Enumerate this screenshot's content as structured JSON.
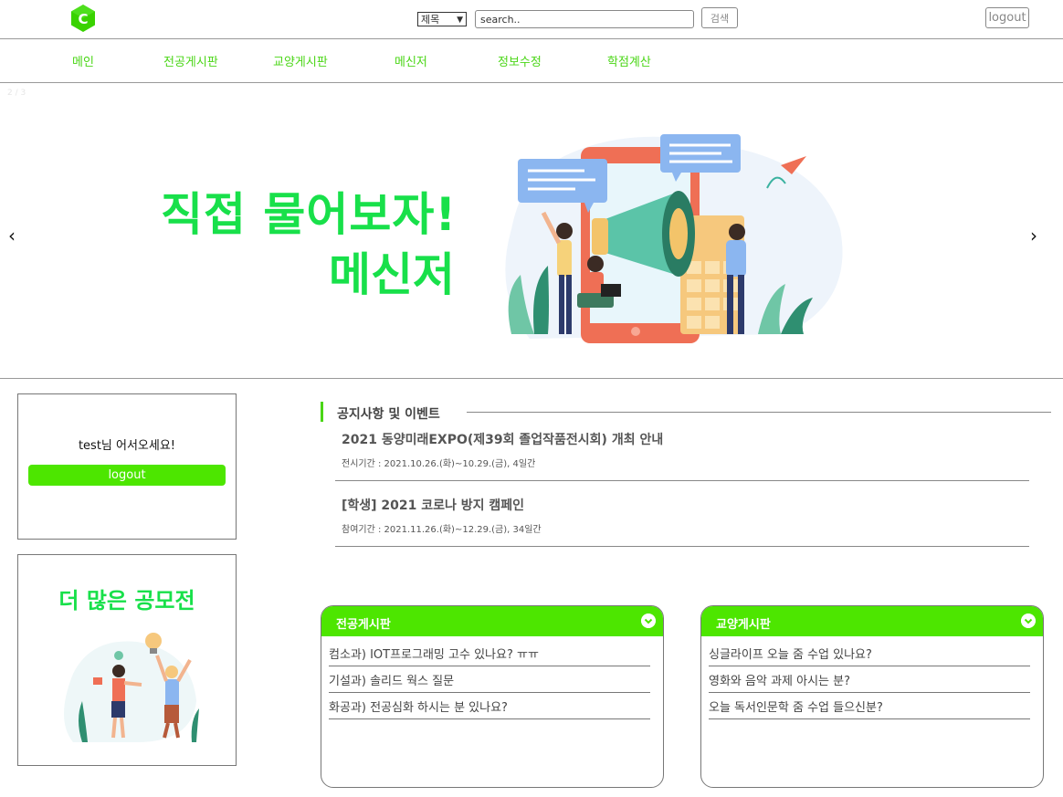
{
  "header": {
    "logo_letter": "C",
    "search_select_value": "제목",
    "search_placeholder": "search..",
    "search_button": "검색",
    "logout_button": "logout"
  },
  "nav": {
    "items": [
      {
        "label": "메인"
      },
      {
        "label": "전공게시판"
      },
      {
        "label": "교양게시판"
      },
      {
        "label": "메신저"
      },
      {
        "label": "정보수정"
      },
      {
        "label": "학점계산"
      }
    ]
  },
  "banner": {
    "slide_counter": "2 / 3",
    "line1": "직접 물어보자!",
    "line2": "메신저",
    "prev_arrow": "‹",
    "next_arrow": "›"
  },
  "welcome": {
    "text": "test님 어서오세요!",
    "logout_button": "logout"
  },
  "contest": {
    "title": "더 많은 공모전"
  },
  "notices": {
    "title": "공지사항 및 이벤트",
    "items": [
      {
        "title": "2021 동양미래EXPO(제39회 졸업작품전시회) 개최 안내",
        "period": "전시기간 : 2021.10.26.(화)~10.29.(금), 4일간"
      },
      {
        "title": "[학생] 2021 코로나 방지 캠페인",
        "period": "참여기간 : 2021.11.26.(화)~12.29.(금), 34일간"
      }
    ]
  },
  "boards": {
    "major": {
      "title": "전공게시판",
      "items": [
        {
          "label": "컴소과) IOT프로그래밍 고수 있나요? ㅠㅠ"
        },
        {
          "label": "기설과) 솔리드 웍스 질문"
        },
        {
          "label": "화공과) 전공심화 하시는 분 있나요?"
        }
      ]
    },
    "liberal": {
      "title": "교양게시판",
      "items": [
        {
          "label": "싱글라이프 오늘 줌 수업 있나요?"
        },
        {
          "label": "영화와 음악 과제 아시는 분?"
        },
        {
          "label": "오늘 독서인문학 줌 수업 들으신분?"
        }
      ]
    }
  },
  "colors": {
    "accent": "#4de600",
    "banner_text": "#18e04a",
    "nav_text": "#4ad616"
  }
}
